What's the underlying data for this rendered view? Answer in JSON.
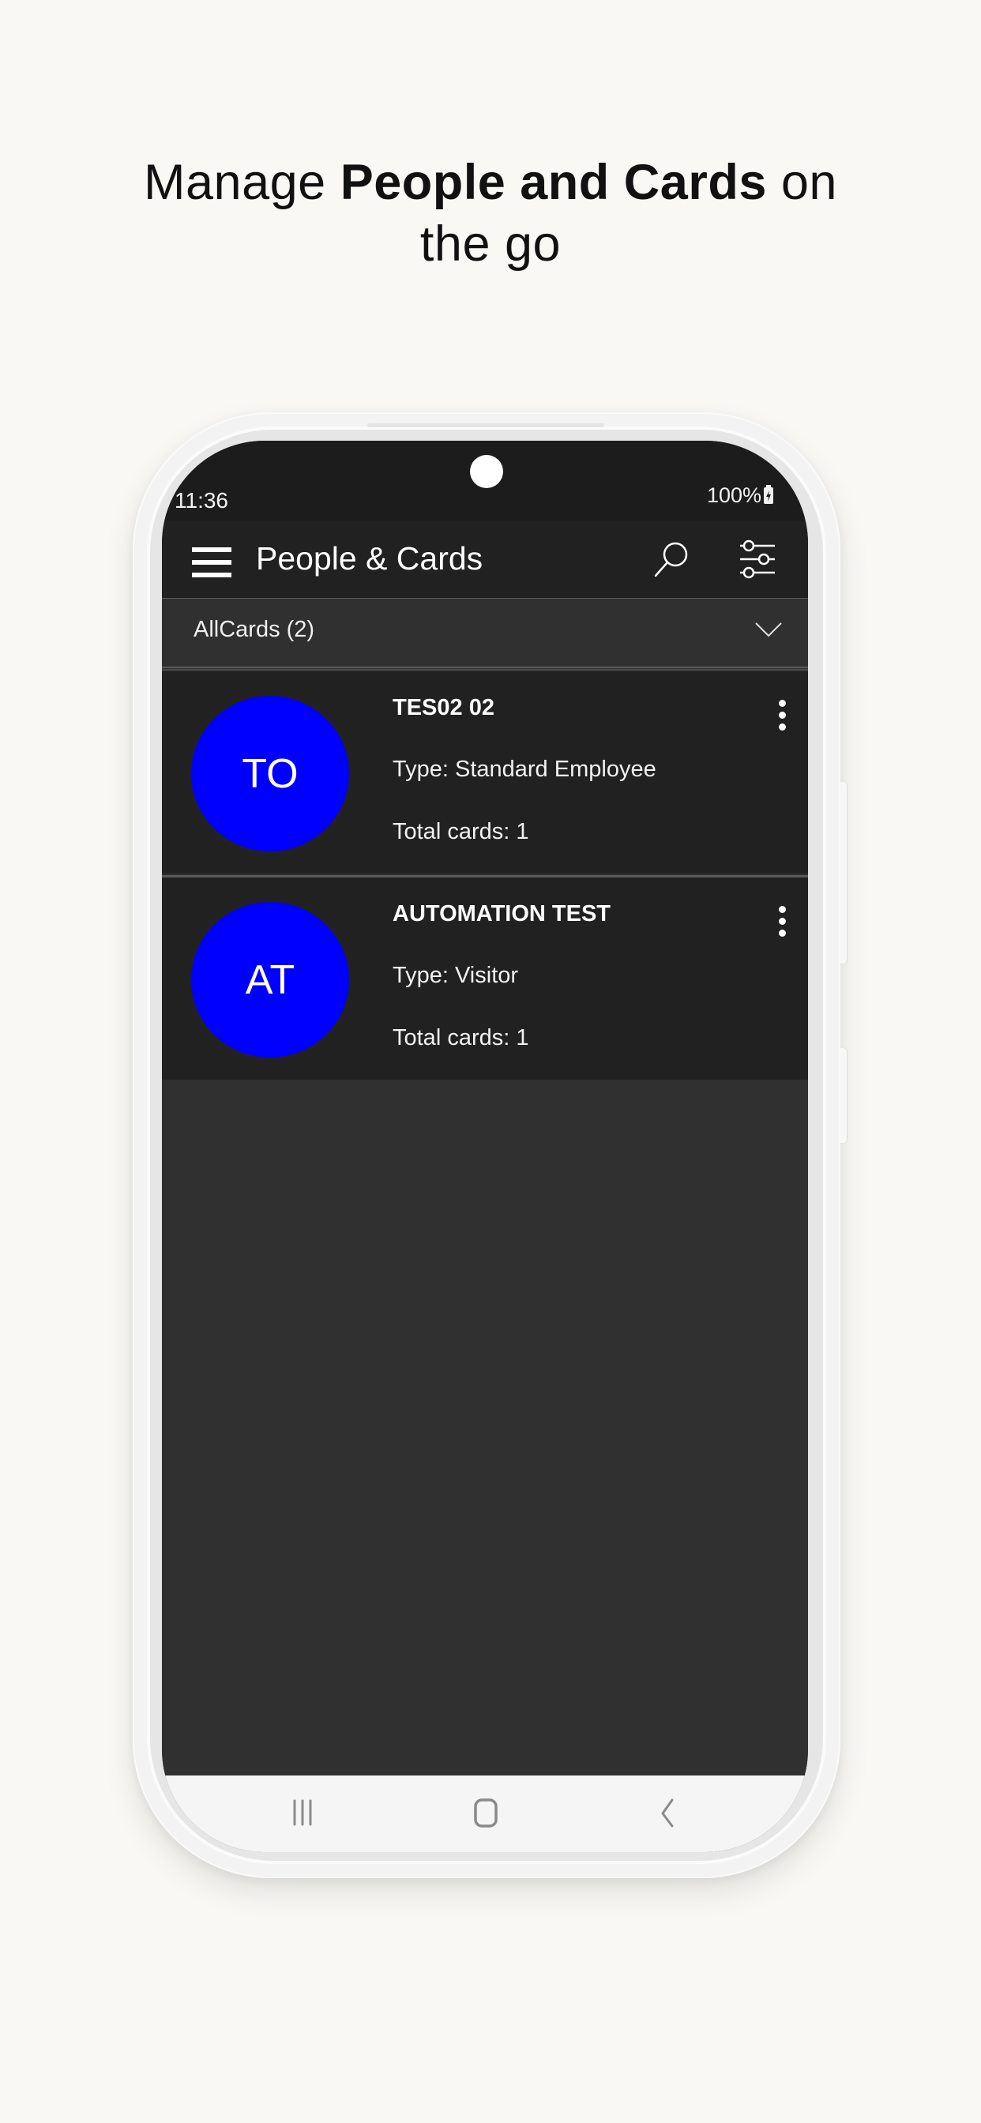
{
  "headline": {
    "line1_prefix": "Manage ",
    "line1_bold": "People and Cards",
    "line1_suffix": " on",
    "line2": "the go"
  },
  "status_bar": {
    "time": "11:36",
    "battery": "100%",
    "battery_icon": "battery-charging-icon"
  },
  "app_bar": {
    "title": "People & Cards",
    "menu_icon": "hamburger-menu-icon",
    "search_icon": "search-icon",
    "filter_icon": "sliders-filter-icon"
  },
  "filter_dropdown": {
    "selected": "AllCards (2)",
    "icon": "chevron-down-icon"
  },
  "people": [
    {
      "initials": "TO",
      "name": "TES02 02",
      "type": "Type: Standard Employee",
      "total_cards": "Total cards: 1",
      "avatar_color": "#0000ff"
    },
    {
      "initials": "AT",
      "name": "AUTOMATION TEST",
      "type": "Type: Visitor",
      "total_cards": "Total cards: 1",
      "avatar_color": "#0000ff"
    }
  ],
  "nav_bar": {
    "recents_icon": "recent-apps-icon",
    "home_icon": "home-icon",
    "back_icon": "back-icon"
  },
  "colors": {
    "page_background": "#f9f8f5",
    "app_bar": "#212121",
    "list_row": "#212121",
    "list_background": "#303030",
    "avatar": "#0000ff",
    "nav_bar": "#f5f5f5"
  }
}
